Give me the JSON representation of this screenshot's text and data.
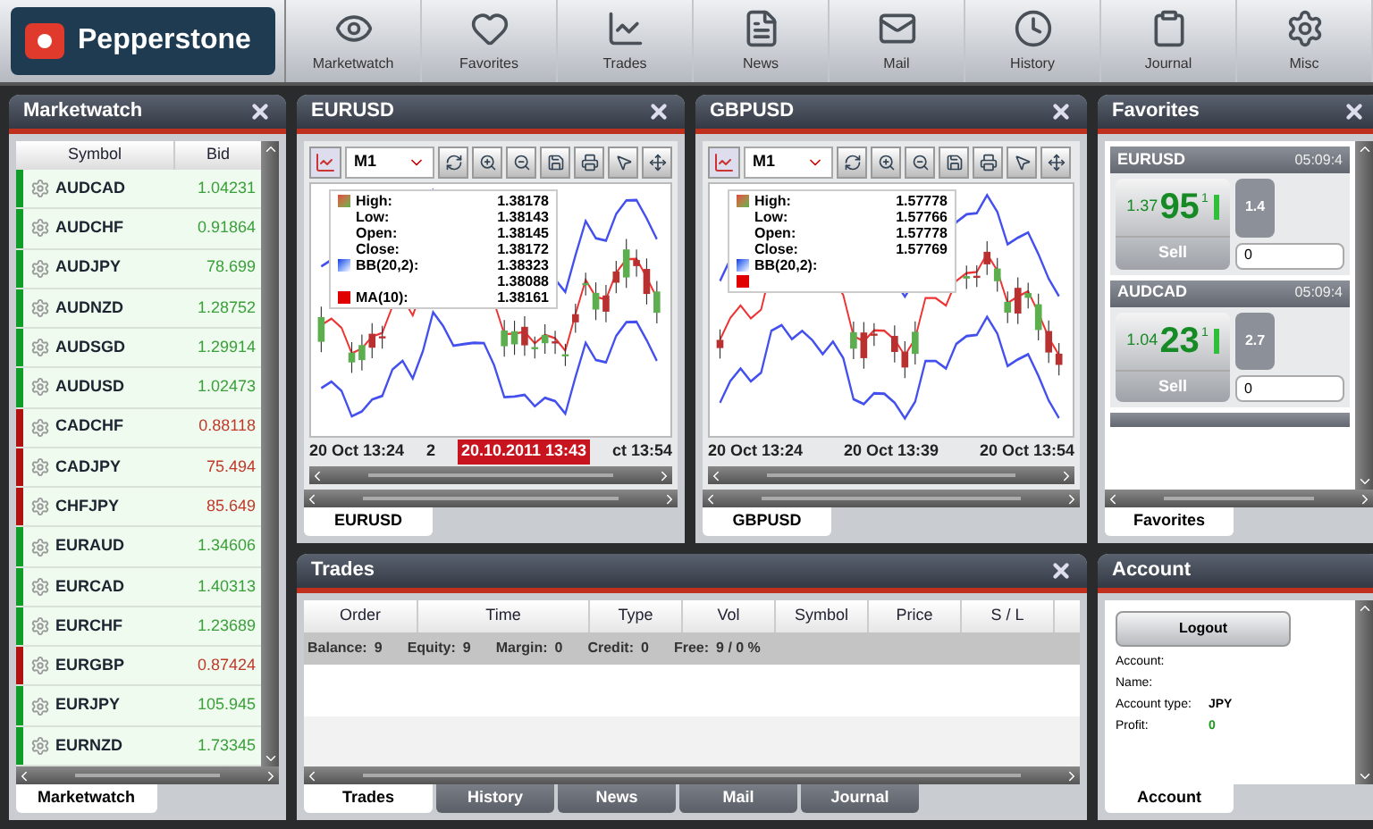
{
  "header": {
    "logo": "Pepperstone",
    "nav": [
      {
        "label": "Marketwatch",
        "kind": "eye"
      },
      {
        "label": "Favorites",
        "kind": "heart"
      },
      {
        "label": "Trades",
        "kind": "chart"
      },
      {
        "label": "News",
        "kind": "document"
      },
      {
        "label": "Mail",
        "kind": "envelope"
      },
      {
        "label": "History",
        "kind": "clock"
      },
      {
        "label": "Journal",
        "kind": "clipboard"
      },
      {
        "label": "Misc",
        "kind": "gear"
      }
    ]
  },
  "marketwatch": {
    "title": "Marketwatch",
    "columns": [
      "Symbol",
      "Bid"
    ],
    "rows": [
      {
        "symbol": "AUDCAD",
        "bid": "1.04231",
        "up": true
      },
      {
        "symbol": "AUDCHF",
        "bid": "0.91864",
        "up": true
      },
      {
        "symbol": "AUDJPY",
        "bid": "78.699",
        "up": true
      },
      {
        "symbol": "AUDNZD",
        "bid": "1.28752",
        "up": true
      },
      {
        "symbol": "AUDSGD",
        "bid": "1.29914",
        "up": true
      },
      {
        "symbol": "AUDUSD",
        "bid": "1.02473",
        "up": true
      },
      {
        "symbol": "CADCHF",
        "bid": "0.88118",
        "up": false
      },
      {
        "symbol": "CADJPY",
        "bid": "75.494",
        "up": false
      },
      {
        "symbol": "CHFJPY",
        "bid": "85.649",
        "up": false
      },
      {
        "symbol": "EURAUD",
        "bid": "1.34606",
        "up": true
      },
      {
        "symbol": "EURCAD",
        "bid": "1.40313",
        "up": true
      },
      {
        "symbol": "EURCHF",
        "bid": "1.23689",
        "up": true
      },
      {
        "symbol": "EURGBP",
        "bid": "0.87424",
        "up": false
      },
      {
        "symbol": "EURJPY",
        "bid": "105.945",
        "up": true
      },
      {
        "symbol": "EURNZD",
        "bid": "1.73345",
        "up": true
      }
    ],
    "tabs": [
      {
        "label": "Marketwatch",
        "selected": true
      }
    ]
  },
  "charts": [
    {
      "title": "EURUSD",
      "timeframe": "M1",
      "legend": [
        {
          "label": "High:",
          "value": "1.38178",
          "kind": "candle"
        },
        {
          "label": "Low:",
          "value": "1.38143"
        },
        {
          "label": "Open:",
          "value": "1.38145"
        },
        {
          "label": "Close:",
          "value": "1.38172"
        },
        {
          "label": "BB(20,2):",
          "value": "1.38323",
          "kind": "bb"
        },
        {
          "value": "1.38088"
        },
        {
          "label": "MA(10):",
          "value": "1.38161",
          "kind": "ma"
        }
      ],
      "x_labels": [
        {
          "text": "20 Oct 13:24",
          "kind": "tick"
        },
        {
          "text": "2",
          "kind": "tick"
        },
        {
          "text": "20.10.2011 13:43",
          "kind": "cursor"
        },
        {
          "text": "ct 13:54",
          "kind": "tick"
        }
      ],
      "tabs": [
        {
          "label": "EURUSD",
          "selected": true
        }
      ]
    },
    {
      "title": "GBPUSD",
      "timeframe": "M1",
      "legend": [
        {
          "label": "High:",
          "value": "1.57778",
          "kind": "candle"
        },
        {
          "label": "Low:",
          "value": "1.57766"
        },
        {
          "label": "Open:",
          "value": "1.57778"
        },
        {
          "label": "Close:",
          "value": "1.57769"
        },
        {
          "label": "BB(20,2):",
          "kind": "bb"
        },
        {
          "kind": "ma"
        }
      ],
      "x_labels": [
        {
          "text": "20 Oct 13:24",
          "kind": "tick"
        },
        {
          "text": "20 Oct 13:39",
          "kind": "tick"
        },
        {
          "text": "20 Oct 13:54",
          "kind": "tick"
        }
      ],
      "tabs": [
        {
          "label": "GBPUSD",
          "selected": true
        }
      ]
    }
  ],
  "favorites": {
    "title": "Favorites",
    "cards": [
      {
        "symbol": "EURUSD",
        "time": "05:09:4",
        "price_prefix": "1.37",
        "price_main": "95",
        "price_sup": "1",
        "action": "Sell",
        "spread": "1.4",
        "volume": "0"
      },
      {
        "symbol": "AUDCAD",
        "time": "05:09:4",
        "price_prefix": "1.04",
        "price_main": "23",
        "price_sup": "1",
        "action": "Sell",
        "spread": "2.7",
        "volume": "0"
      }
    ],
    "tabs": [
      {
        "label": "Favorites",
        "selected": true
      }
    ]
  },
  "trades": {
    "title": "Trades",
    "columns": [
      "Order",
      "Time",
      "Type",
      "Vol",
      "Symbol",
      "Price",
      "S / L"
    ],
    "summary": [
      {
        "label": "Balance:",
        "value": "9"
      },
      {
        "label": "Equity:",
        "value": "9"
      },
      {
        "label": "Margin:",
        "value": "0"
      },
      {
        "label": "Credit:",
        "value": "0"
      },
      {
        "label": "Free:",
        "value": "9 / 0 %"
      }
    ],
    "tabs": [
      {
        "label": "Trades",
        "selected": true
      },
      {
        "label": "History",
        "selected": false
      },
      {
        "label": "News",
        "selected": false
      },
      {
        "label": "Mail",
        "selected": false
      },
      {
        "label": "Journal",
        "selected": false
      }
    ]
  },
  "account": {
    "title": "Account",
    "button": "Logout",
    "fields": [
      {
        "label": "Account:"
      },
      {
        "label": "Name:"
      },
      {
        "label": "Account type:",
        "value": "JPY"
      },
      {
        "label": "Profit:",
        "value": "0",
        "kind": "profit"
      }
    ],
    "tabs": [
      {
        "label": "Account",
        "selected": true
      }
    ]
  }
}
